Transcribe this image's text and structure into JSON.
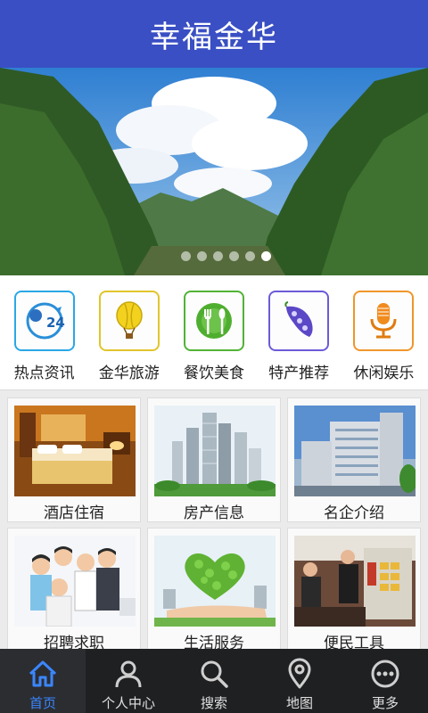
{
  "header": {
    "title": "幸福金华"
  },
  "banner": {
    "slide_count": 6,
    "active_slide": 6
  },
  "quick_links": [
    {
      "label": "热点资讯",
      "icon": "clock-24-icon",
      "color": "#2aa7e6"
    },
    {
      "label": "金华旅游",
      "icon": "balloon-icon",
      "color": "#e1c52b"
    },
    {
      "label": "餐饮美食",
      "icon": "dining-icon",
      "color": "#51b335"
    },
    {
      "label": "特产推荐",
      "icon": "pea-pod-icon",
      "color": "#6b5bd8"
    },
    {
      "label": "休闲娱乐",
      "icon": "microphone-icon",
      "color": "#f0962a"
    }
  ],
  "cards": [
    {
      "label": "酒店住宿",
      "image": "hotel-room-image"
    },
    {
      "label": "房产信息",
      "image": "city-buildings-image"
    },
    {
      "label": "名企介绍",
      "image": "office-building-image"
    },
    {
      "label": "招聘求职",
      "image": "people-group-image"
    },
    {
      "label": "生活服务",
      "image": "green-heart-image"
    },
    {
      "label": "便民工具",
      "image": "market-stall-image"
    }
  ],
  "tabbar": {
    "active": "首页",
    "items": [
      {
        "label": "首页",
        "icon": "home-icon"
      },
      {
        "label": "个人中心",
        "icon": "person-icon"
      },
      {
        "label": "搜索",
        "icon": "search-icon"
      },
      {
        "label": "地图",
        "icon": "map-pin-icon"
      },
      {
        "label": "更多",
        "icon": "more-icon"
      }
    ]
  },
  "colors": {
    "header": "#3a4fc3",
    "tabbar": "#1f2022",
    "tab_active": "#3b86ff"
  }
}
